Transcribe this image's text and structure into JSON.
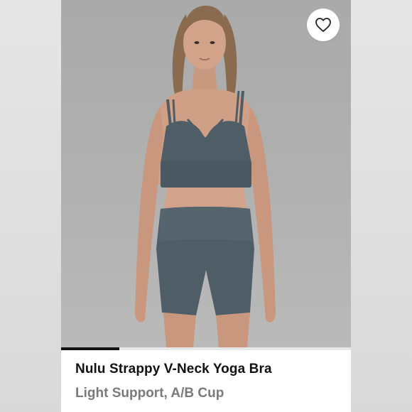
{
  "product": {
    "name": "Nulu Strappy V-Neck Yoga Bra",
    "variant": "Light Support, A/B Cup"
  },
  "gallery": {
    "progress": 0.2,
    "favorite_icon": "heart-outline-icon"
  },
  "colors": {
    "garment": "#4f5d67",
    "accent": "#111111"
  }
}
